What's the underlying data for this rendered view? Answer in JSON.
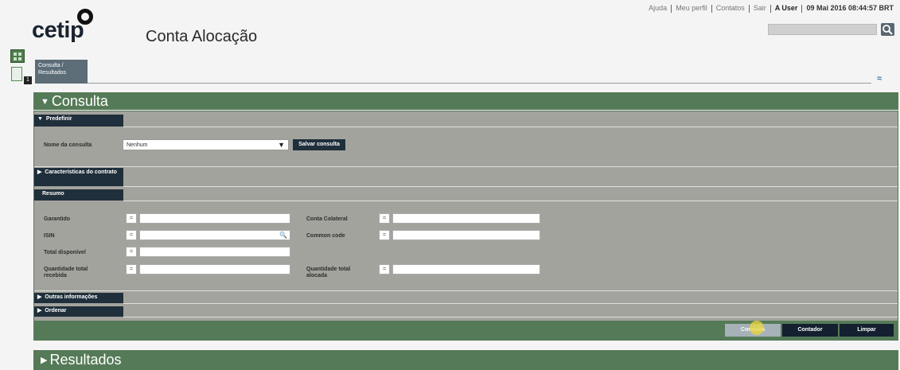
{
  "top_links": {
    "ajuda": "Ajuda",
    "meu_perfil": "Meu perfil",
    "contatos": "Contatos",
    "sair": "Sair",
    "user": "A User",
    "datetime": "09 Mai 2016 08:44:57 BRT"
  },
  "logo_text": "cetip",
  "app_title": "Conta Alocação",
  "tab": {
    "label": "Consulta / Resultados"
  },
  "side_badge": "1",
  "consulta": {
    "title": "Consulta",
    "predefinir": {
      "header": "Predefinir",
      "nome_label": "Nome da consulta",
      "nome_value": "Nenhum",
      "salvar_label": "Salvar consulta"
    },
    "caracteristicas_header": "Características do contrato",
    "resumo": {
      "header": "Resumo",
      "fields": {
        "garantido": "Garantido",
        "isin": "ISIN",
        "total_disponivel": "Total disponível",
        "qtd_recebida": "Quantidade total recebida",
        "conta_colateral": "Conta Colateral",
        "common_code": "Common code",
        "qtd_alocada": "Quantidade total alocada"
      },
      "operator": "="
    },
    "outras_header": "Outras informações",
    "ordenar_header": "Ordenar",
    "buttons": {
      "consulta": "Consulta",
      "contador": "Contador",
      "limpar": "Limpar"
    }
  },
  "resultados": {
    "title": "Resultados"
  },
  "icons": {
    "search": "search-icon",
    "collapse": "double-chevron-icon",
    "dropdown": "caret-down-icon"
  },
  "colors": {
    "section_green": "#557a57",
    "panel_gray": "#a3a39d",
    "dark_navy": "#1f2f3b"
  }
}
